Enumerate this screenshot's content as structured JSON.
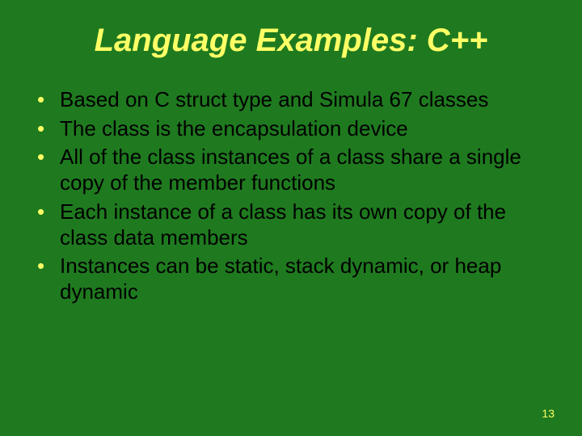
{
  "slide": {
    "title": "Language Examples: C++",
    "bullets": [
      "Based on C struct type and Simula 67 classes",
      "The class is the encapsulation device",
      "All of the class instances of a class share a single copy of the member functions",
      "Each instance of a class has its own copy of the class data members",
      "Instances can be static, stack dynamic, or heap dynamic"
    ],
    "page_number": "13"
  }
}
